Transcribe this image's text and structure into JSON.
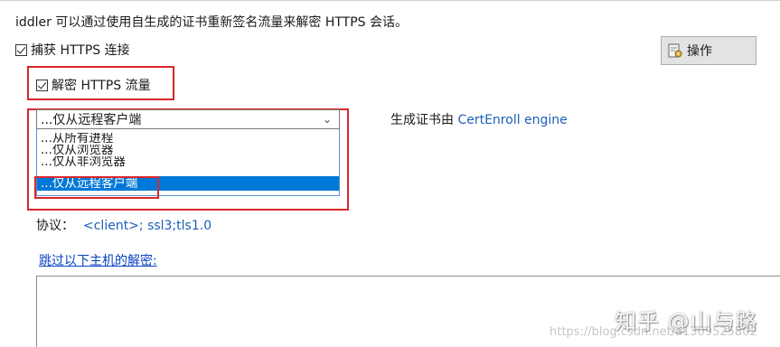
{
  "intro_text": "iddler 可以通过使用自生成的证书重新签名流量来解密 HTTPS 会话。",
  "capture_https": {
    "label": "捕获 HTTPS 连接",
    "checked": true
  },
  "decrypt_https": {
    "label": "解密 HTTPS 流量",
    "checked": true
  },
  "action_button": {
    "label": "操作",
    "icon": "certificate-action-icon"
  },
  "traffic_source": {
    "selected": "...仅从远程客户端",
    "options": [
      "...从所有进程",
      "...仅从浏览器",
      "...仅从非浏览器",
      "...仅从远程客户端"
    ]
  },
  "cert_generator": {
    "prefix": "生成证书由",
    "value": "CertEnroll engine"
  },
  "protocols": {
    "label": "协议：",
    "value": "<client>; ssl3;tls1.0"
  },
  "skip_hosts_link": "跳过以下主机的解密:",
  "skip_hosts_value": "",
  "watermark": {
    "text": "知乎 @山与路",
    "url": "https://blog.csdn.net/a1309525802"
  },
  "colors": {
    "highlight_red": "#d9262a",
    "selection_blue": "#0078d7",
    "link_blue": "#0a44c2"
  }
}
